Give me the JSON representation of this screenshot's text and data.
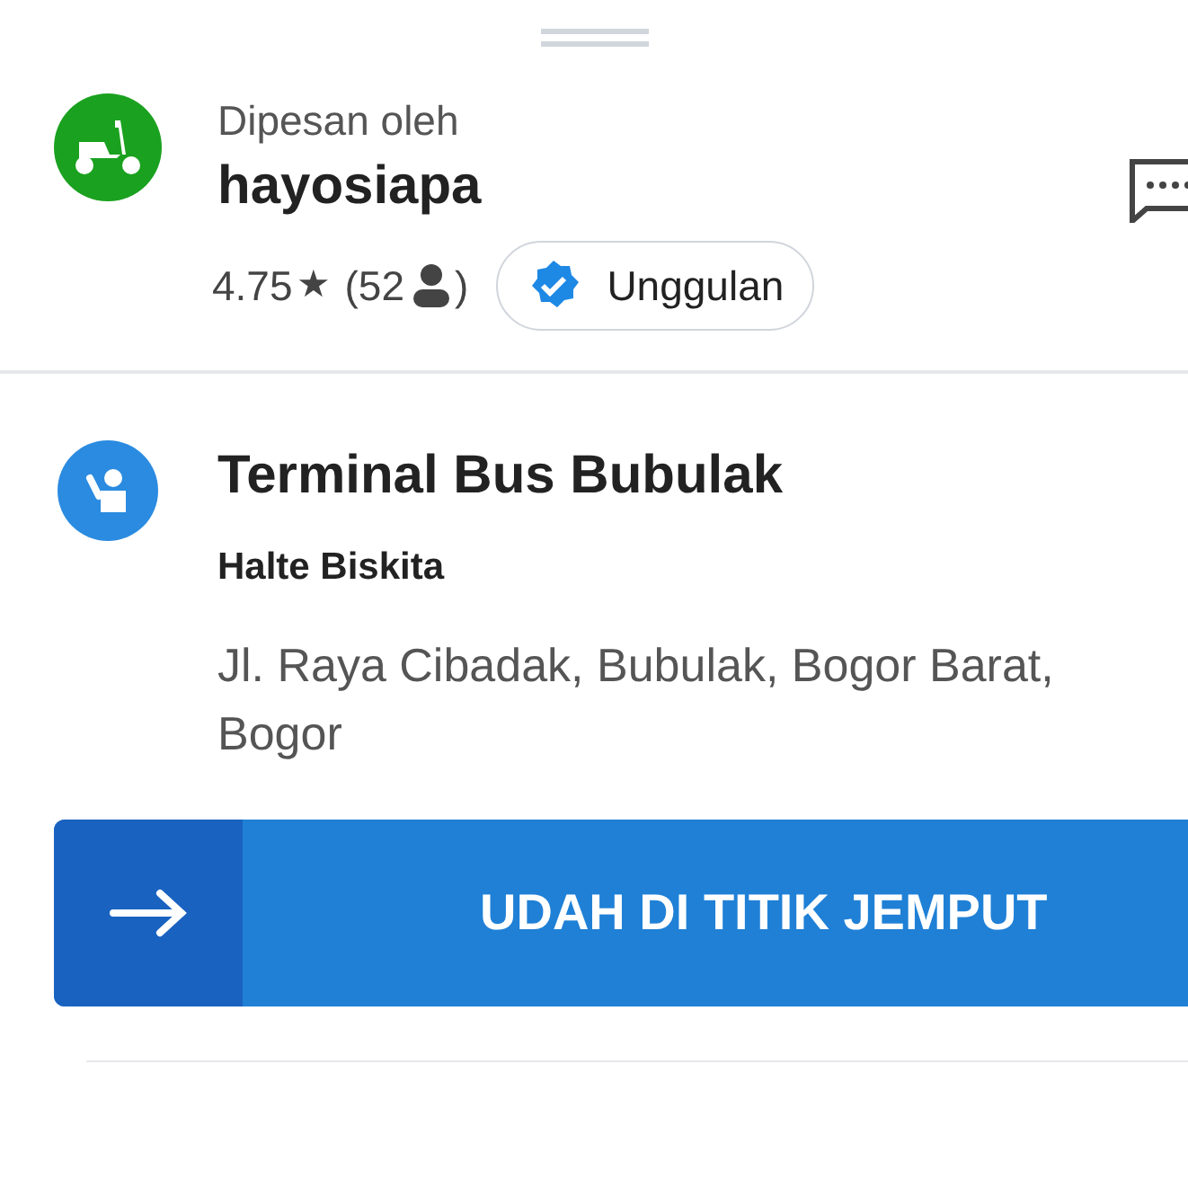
{
  "orderer": {
    "caption": "Dipesan oleh",
    "name": "hayosiapa",
    "rating": "4.75",
    "star": "★",
    "count_open": "(52",
    "count_close": ")",
    "badge": "Unggulan"
  },
  "pickup": {
    "title": "Terminal Bus Bubulak",
    "subtitle": "Halte Biskita",
    "address_lines": [
      "Jl. Raya Cibadak, Bubulak, Bogor Barat,",
      "Bogor"
    ]
  },
  "action_button": {
    "label": "UDAH DI TITIK JEMPUT"
  }
}
